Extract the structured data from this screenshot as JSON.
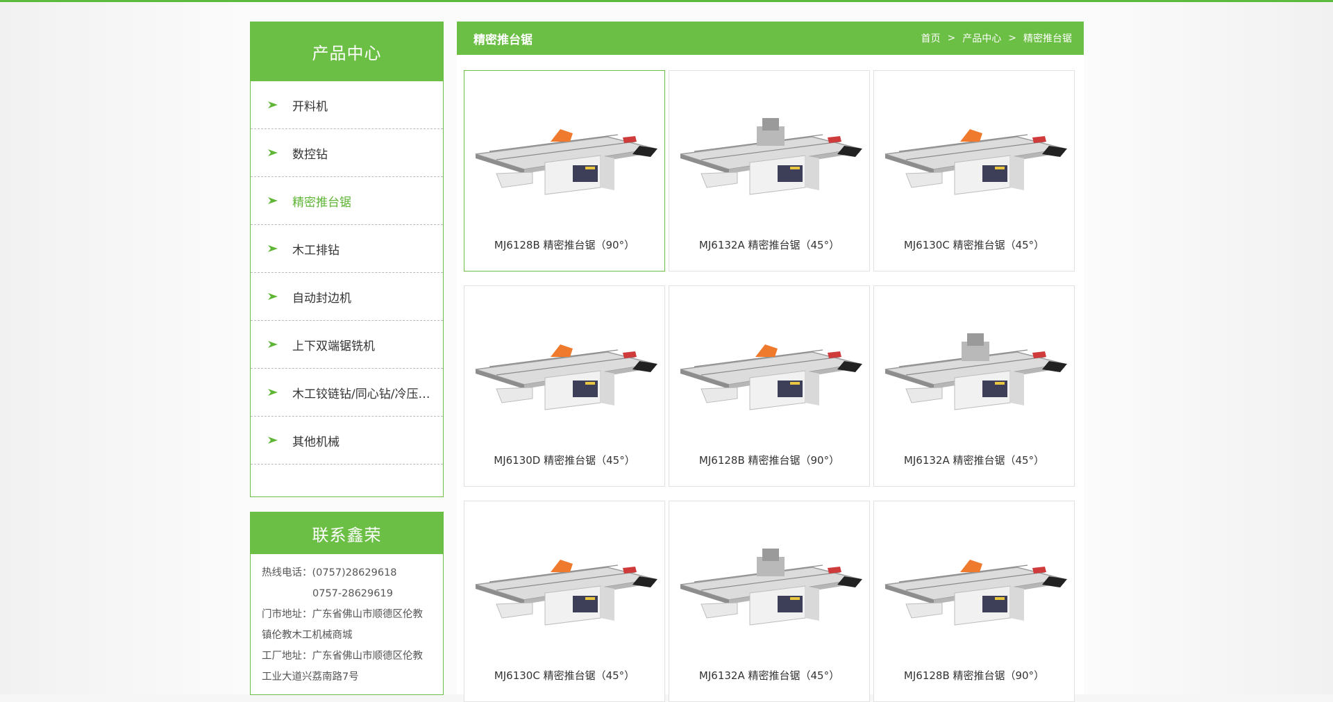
{
  "sidebar": {
    "title": "产品中心",
    "items": [
      {
        "label": "开料机"
      },
      {
        "label": "数控钻"
      },
      {
        "label": "精密推台锯",
        "active": true
      },
      {
        "label": "木工排钻"
      },
      {
        "label": "自动封边机"
      },
      {
        "label": "上下双端锯铣机"
      },
      {
        "label": "木工铰链钻/同心钻/冷压机..."
      },
      {
        "label": "其他机械"
      }
    ]
  },
  "contact": {
    "title": "联系鑫荣",
    "hotline_label": "热线电话：",
    "hotline_1": "(0757)28629618",
    "hotline_2": "0757-28629619",
    "store_label": "门市地址：",
    "store_line1": "广东省佛山市顺德区伦教",
    "store_line2": "镇伦教木工机械商城",
    "factory_label": "工厂地址：",
    "factory_line1": "广东省佛山市顺德区伦教",
    "factory_line2": "工业大道兴荔南路7号"
  },
  "main": {
    "title": "精密推台锯",
    "breadcrumb": [
      "首页",
      "产品中心",
      "精密推台锯"
    ],
    "breadcrumb_sep": ">"
  },
  "products": [
    {
      "name": "MJ6128B 精密推台锯（90°）",
      "active": true
    },
    {
      "name": "MJ6132A 精密推台锯（45°）"
    },
    {
      "name": "MJ6130C 精密推台锯（45°）"
    },
    {
      "name": "MJ6130D 精密推台锯（45°）"
    },
    {
      "name": "MJ6128B 精密推台锯（90°）"
    },
    {
      "name": "MJ6132A 精密推台锯（45°）"
    },
    {
      "name": "MJ6130C 精密推台锯（45°）"
    },
    {
      "name": "MJ6132A 精密推台锯（45°）"
    },
    {
      "name": "MJ6128B 精密推台锯（90°）"
    }
  ],
  "colors": {
    "accent": "#6cbf45",
    "active_text": "#5fb536"
  }
}
